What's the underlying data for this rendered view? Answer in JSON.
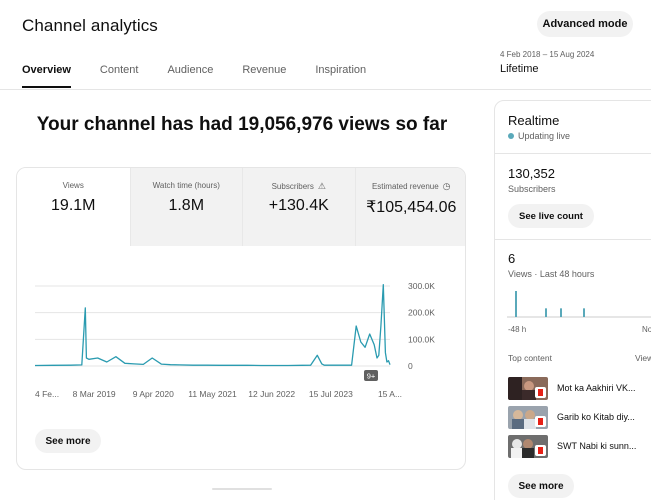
{
  "header": {
    "title": "Channel analytics",
    "advanced_mode": "Advanced mode",
    "tabs": [
      {
        "label": "Overview",
        "active": true
      },
      {
        "label": "Content",
        "active": false
      },
      {
        "label": "Audience",
        "active": false
      },
      {
        "label": "Revenue",
        "active": false
      },
      {
        "label": "Inspiration",
        "active": false
      }
    ],
    "date_range": "4 Feb 2018 – 15 Aug 2024",
    "date_label": "Lifetime"
  },
  "main": {
    "headline": "Your channel has had 19,056,976 views so far",
    "metrics": [
      {
        "label": "Views",
        "value": "19.1M",
        "icon": ""
      },
      {
        "label": "Watch time (hours)",
        "value": "1.8M",
        "icon": ""
      },
      {
        "label": "Subscribers",
        "value": "+130.4K",
        "icon": "warning-icon"
      },
      {
        "label": "Estimated revenue",
        "value": "₹105,454.06",
        "icon": "clock-icon"
      }
    ],
    "see_more": "See more",
    "badge": "9+"
  },
  "chart_data": {
    "type": "line",
    "title": "",
    "x_tick_labels": [
      "4 Fe...",
      "8 Mar 2019",
      "9 Apr 2020",
      "11 May 2021",
      "12 Jun 2022",
      "15 Jul 2023",
      "15 A..."
    ],
    "y_tick_labels": [
      "300.0K",
      "200.0K",
      "100.0K",
      "0"
    ],
    "ylim": [
      0,
      300000
    ],
    "series": [
      {
        "color": "#2a9bb0",
        "x": [
          "2018-02-04",
          "2018-06-01",
          "2018-10-01",
          "2018-12-15",
          "2019-01-08",
          "2019-01-15",
          "2019-02-01",
          "2019-04-01",
          "2019-06-01",
          "2019-08-01",
          "2019-10-01",
          "2019-12-01",
          "2020-02-01",
          "2020-04-01",
          "2020-06-01",
          "2020-08-01",
          "2020-10-01",
          "2021-01-01",
          "2021-04-01",
          "2021-07-01",
          "2021-10-01",
          "2022-01-01",
          "2022-04-01",
          "2022-07-01",
          "2022-10-01",
          "2023-01-01",
          "2023-03-01",
          "2023-04-15",
          "2023-05-15",
          "2023-06-01",
          "2023-09-01",
          "2023-12-01",
          "2024-01-01",
          "2024-02-01",
          "2024-03-01",
          "2024-04-01",
          "2024-05-01",
          "2024-05-20",
          "2024-06-01",
          "2024-06-15",
          "2024-07-01",
          "2024-07-15",
          "2024-07-25",
          "2024-08-05",
          "2024-08-15"
        ],
        "values": [
          2000,
          2500,
          3000,
          4000,
          218000,
          30000,
          25000,
          30000,
          15000,
          35000,
          10000,
          8000,
          6000,
          30000,
          7000,
          5000,
          4000,
          3000,
          3000,
          2500,
          2500,
          2500,
          2000,
          2000,
          2000,
          2500,
          3000,
          40000,
          8000,
          3000,
          3000,
          3000,
          150000,
          90000,
          70000,
          120000,
          80000,
          30000,
          40000,
          150000,
          305000,
          50000,
          15000,
          20000,
          5000
        ]
      }
    ],
    "grid": true
  },
  "sidebar": {
    "title": "Realtime",
    "live": "Updating live",
    "sub_count": "130,352",
    "sub_label": "Subscribers",
    "see_live": "See live count",
    "views_count": "6",
    "views_label": "Views · Last 48 hours",
    "rt_left": "-48 h",
    "rt_right": "No",
    "top_content": "Top content",
    "top_content_right": "Views",
    "rt_bars": [
      3,
      1,
      1,
      1
    ],
    "items": [
      {
        "title": "Mot ka Aakhiri VK..."
      },
      {
        "title": "Garib ko Kitab diy..."
      },
      {
        "title": "SWT Nabi ki sunn..."
      }
    ],
    "see_more": "See more"
  }
}
